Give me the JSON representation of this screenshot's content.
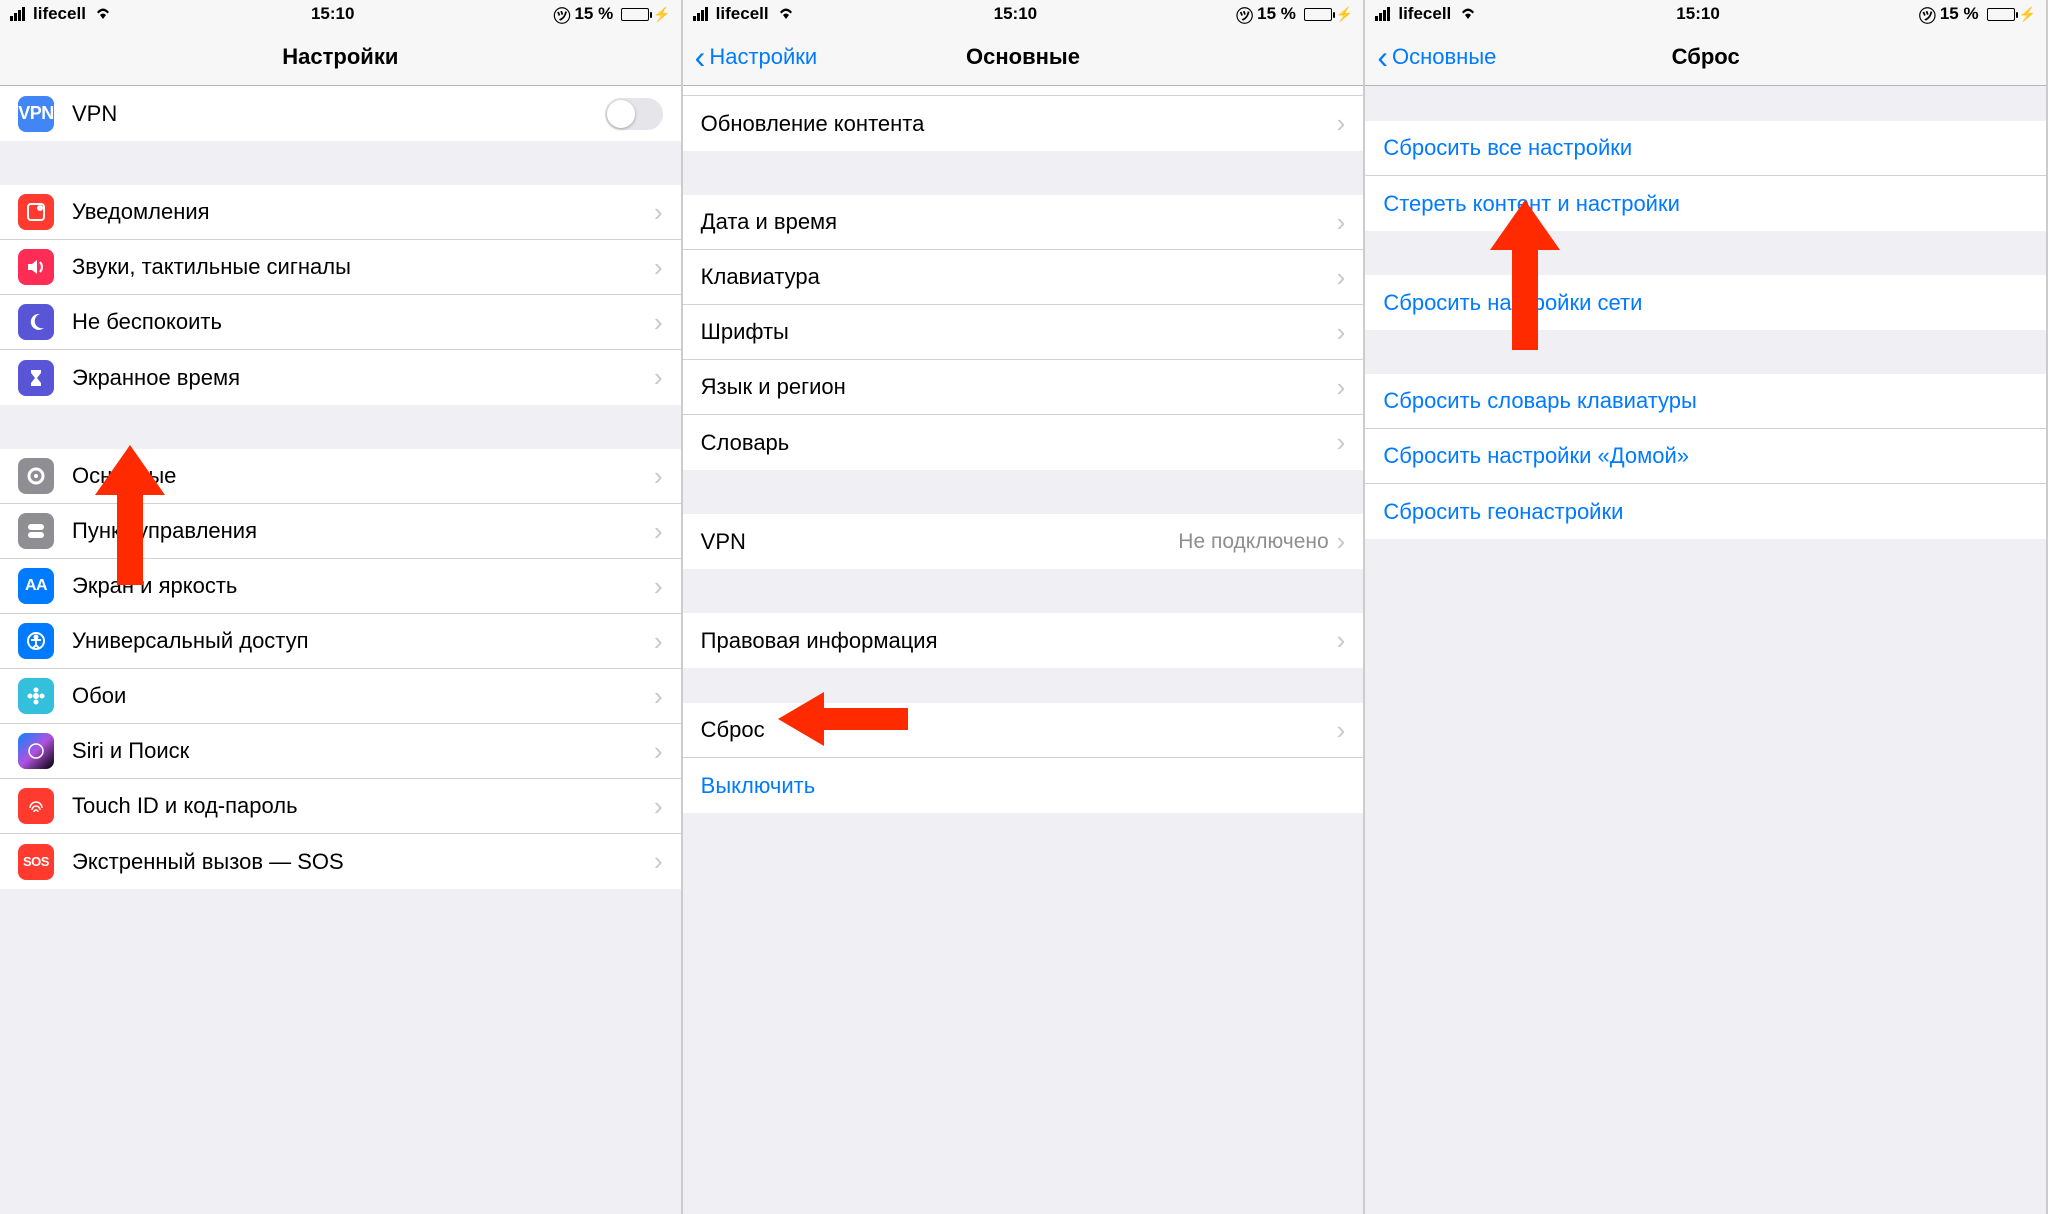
{
  "status": {
    "carrier": "lifecell",
    "time": "15:10",
    "battery_pct": "15 %"
  },
  "panel1": {
    "title": "Настройки",
    "vpn": "VPN",
    "group_notifications": [
      {
        "icon": "notif",
        "label": "Уведомления"
      },
      {
        "icon": "sound",
        "label": "Звуки, тактильные сигналы"
      },
      {
        "icon": "dnd",
        "label": "Не беспокоить"
      },
      {
        "icon": "screen",
        "label": "Экранное время"
      }
    ],
    "group_general": [
      {
        "icon": "general",
        "label": "Основные"
      },
      {
        "icon": "control",
        "label": "Пункт управления"
      },
      {
        "icon": "display",
        "label": "Экран и яркость"
      },
      {
        "icon": "acc",
        "label": "Универсальный доступ"
      },
      {
        "icon": "wall",
        "label": "Обои"
      },
      {
        "icon": "siri",
        "label": "Siri и Поиск"
      },
      {
        "icon": "touch",
        "label": "Touch ID и код-пароль"
      },
      {
        "icon": "sos",
        "label": "Экстренный вызов — SOS"
      }
    ]
  },
  "panel2": {
    "back": "Настройки",
    "title": "Основные",
    "group_a": [
      "Обновление контента"
    ],
    "group_b": [
      "Дата и время",
      "Клавиатура",
      "Шрифты",
      "Язык и регион",
      "Словарь"
    ],
    "vpn_label": "VPN",
    "vpn_value": "Не подключено",
    "group_d": [
      "Правовая информация"
    ],
    "reset": "Сброс",
    "shutdown": "Выключить"
  },
  "panel3": {
    "back": "Основные",
    "title": "Сброс",
    "group_a": [
      "Сбросить все настройки",
      "Стереть контент и настройки"
    ],
    "group_b": [
      "Сбросить настройки сети"
    ],
    "group_c": [
      "Сбросить словарь клавиатуры",
      "Сбросить настройки «Домой»",
      "Сбросить геонастройки"
    ]
  }
}
